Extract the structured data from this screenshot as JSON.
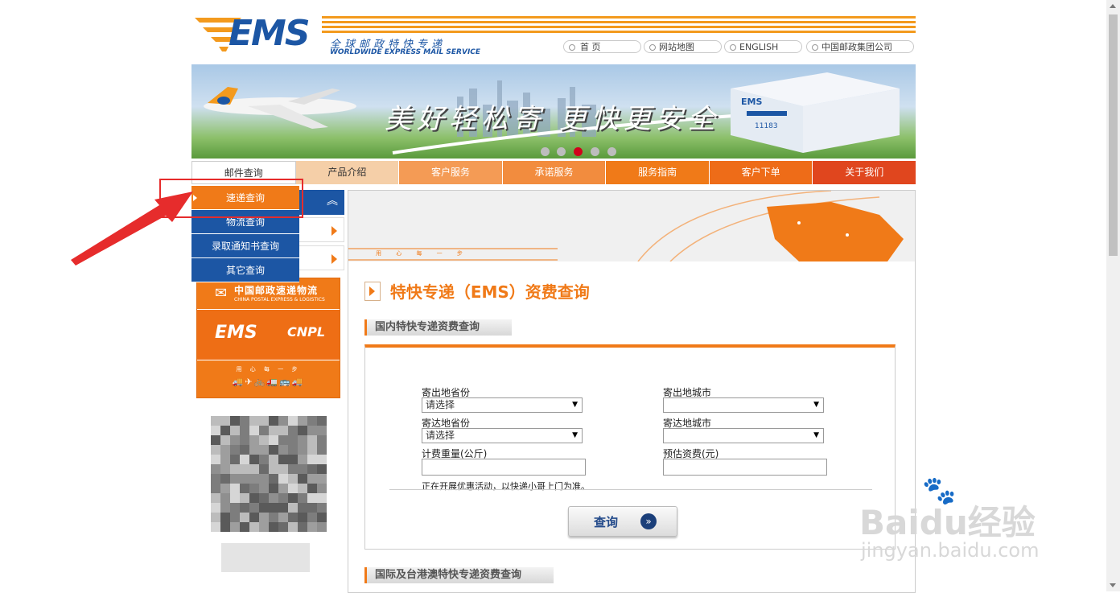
{
  "header": {
    "logo_text": "EMS",
    "logo_cn": "全球邮政特快专递",
    "logo_en": "WORLDWIDE EXPRESS MAIL SERVICE",
    "links": [
      "首 页",
      "网站地图",
      "ENGLISH",
      "中国邮政集团公司"
    ]
  },
  "banner": {
    "slogan": "美好轻松寄 更快更安全",
    "box_label": "EMS",
    "phone": "11183",
    "active_dot": 2,
    "dot_count": 5
  },
  "nav": {
    "items": [
      "邮件查询",
      "产品介绍",
      "客户服务",
      "承诺服务",
      "服务指南",
      "客户下单",
      "关于我们"
    ]
  },
  "dropdown": {
    "items": [
      "速递查询",
      "物流查询",
      "录取通知书查询",
      "其它查询"
    ],
    "active": "速递查询"
  },
  "sidebar": {
    "cnpl_cn": "中国邮政速递物流",
    "cnpl_en": "CHINA POSTAL EXPRESS & LOGISTICS",
    "ems": "EMS",
    "cnpl": "CNPL",
    "slogan": "用 心 每 一 步"
  },
  "main": {
    "banner_slogan": "用 心 每 一 步",
    "title": "特快专递（EMS）资费查询",
    "domestic_tab": "国内特快专递资费查询",
    "intl_tab": "国际及台港澳特快专递资费查询",
    "form": {
      "from_province_label": "寄出地省份",
      "from_province_value": "请选择",
      "from_city_label": "寄出地城市",
      "from_city_value": "",
      "to_province_label": "寄达地省份",
      "to_province_value": "请选择",
      "to_city_label": "寄达地城市",
      "to_city_value": "",
      "weight_label": "计费重量(公斤)",
      "weight_value": "",
      "fee_label": "预估资费(元)",
      "fee_value": "",
      "notice": "正在开展优惠活动，以快递小哥上门为准。",
      "query_label": "查询",
      "query_icon": "»"
    }
  },
  "watermark": {
    "brand": "Baidu经验",
    "url": "jingyan.baidu.com"
  },
  "colors": {
    "orange": "#f07a18",
    "blue": "#1c56a4",
    "red_highlight": "#e62c2c"
  }
}
